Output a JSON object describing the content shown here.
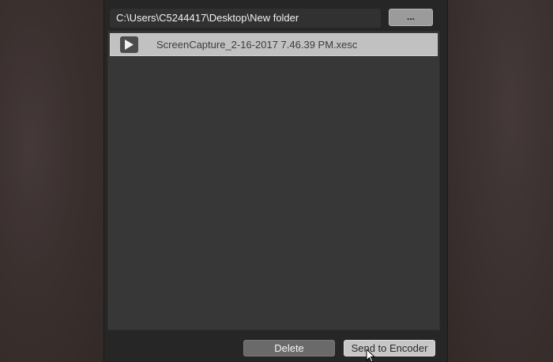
{
  "path_bar": {
    "value": "C:\\Users\\C5244417\\Desktop\\New folder",
    "browse_label": "..."
  },
  "recordings": [
    {
      "name": "ScreenCapture_2-16-2017 7.46.39 PM.xesc",
      "selected": true
    }
  ],
  "icons": {
    "play": "play-icon",
    "cursor": "mouse-pointer-icon"
  },
  "actions": {
    "delete_label": "Delete",
    "send_label": "Send to Encoder"
  },
  "colors": {
    "window_bg": "#262626",
    "list_bg": "#373737",
    "selected_row": "#c1c1c1",
    "primary_button": "#c7c7c7",
    "secondary_button": "#6a6a6a"
  }
}
